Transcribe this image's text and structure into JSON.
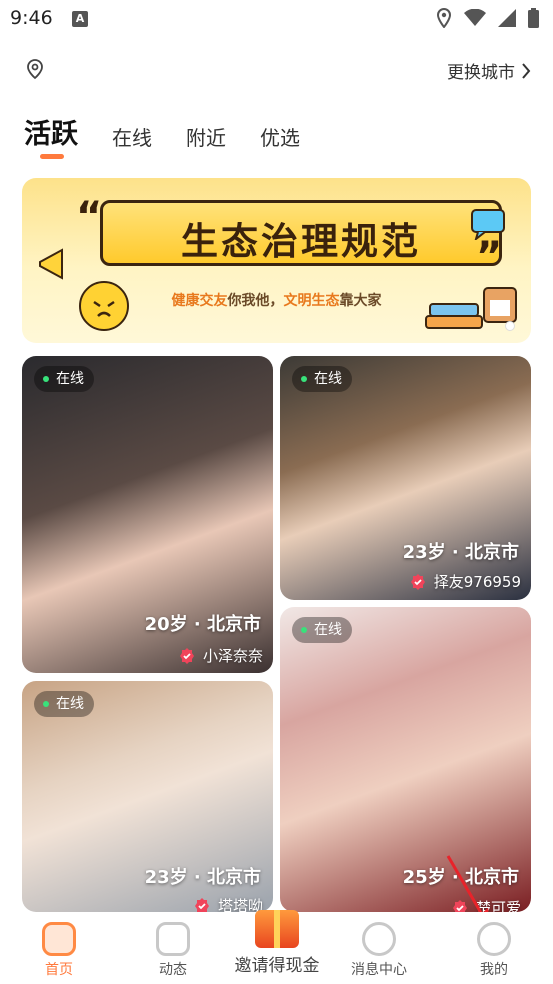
{
  "status_bar": {
    "time": "9:46",
    "notification_icon": "a-icon",
    "icons": [
      "location-icon",
      "wifi-icon",
      "signal-icon",
      "battery-icon"
    ]
  },
  "location": {
    "pin_icon": "location-pin-icon",
    "change_city": "更换城市"
  },
  "tabs": [
    {
      "label": "活跃",
      "active": true
    },
    {
      "label": "在线",
      "active": false
    },
    {
      "label": "附近",
      "active": false
    },
    {
      "label": "优选",
      "active": false
    }
  ],
  "banner": {
    "title": "生态治理规范",
    "subtitle_part1": "健康交友",
    "subtitle_part2": "你我他，",
    "subtitle_part3": "文明生态",
    "subtitle_part4": "靠大家"
  },
  "cards": [
    {
      "online": "在线",
      "age_city": "20岁 · 北京市",
      "nickname": "小泽奈奈"
    },
    {
      "online": "在线",
      "age_city": "23岁 · 北京市",
      "nickname": "择友976959"
    },
    {
      "online": "在线",
      "age_city": "25岁 · 北京市",
      "nickname": "楚可爱"
    },
    {
      "online": "在线",
      "age_city": "23岁 · 北京市",
      "nickname": "塔塔呦"
    }
  ],
  "bottom_nav": [
    {
      "label": "首页",
      "icon": "home-icon",
      "active": true
    },
    {
      "label": "动态",
      "icon": "feed-icon",
      "active": false
    },
    {
      "label": "邀请得现金",
      "icon": "gift-icon",
      "active": false
    },
    {
      "label": "消息中心",
      "icon": "message-icon",
      "active": false
    },
    {
      "label": "我的",
      "icon": "profile-icon",
      "active": false
    }
  ],
  "colors": {
    "accent": "#ff7a3d",
    "online_dot": "#38e27b",
    "badge": "#f0445a",
    "annotation_arrow": "#e8232a"
  }
}
